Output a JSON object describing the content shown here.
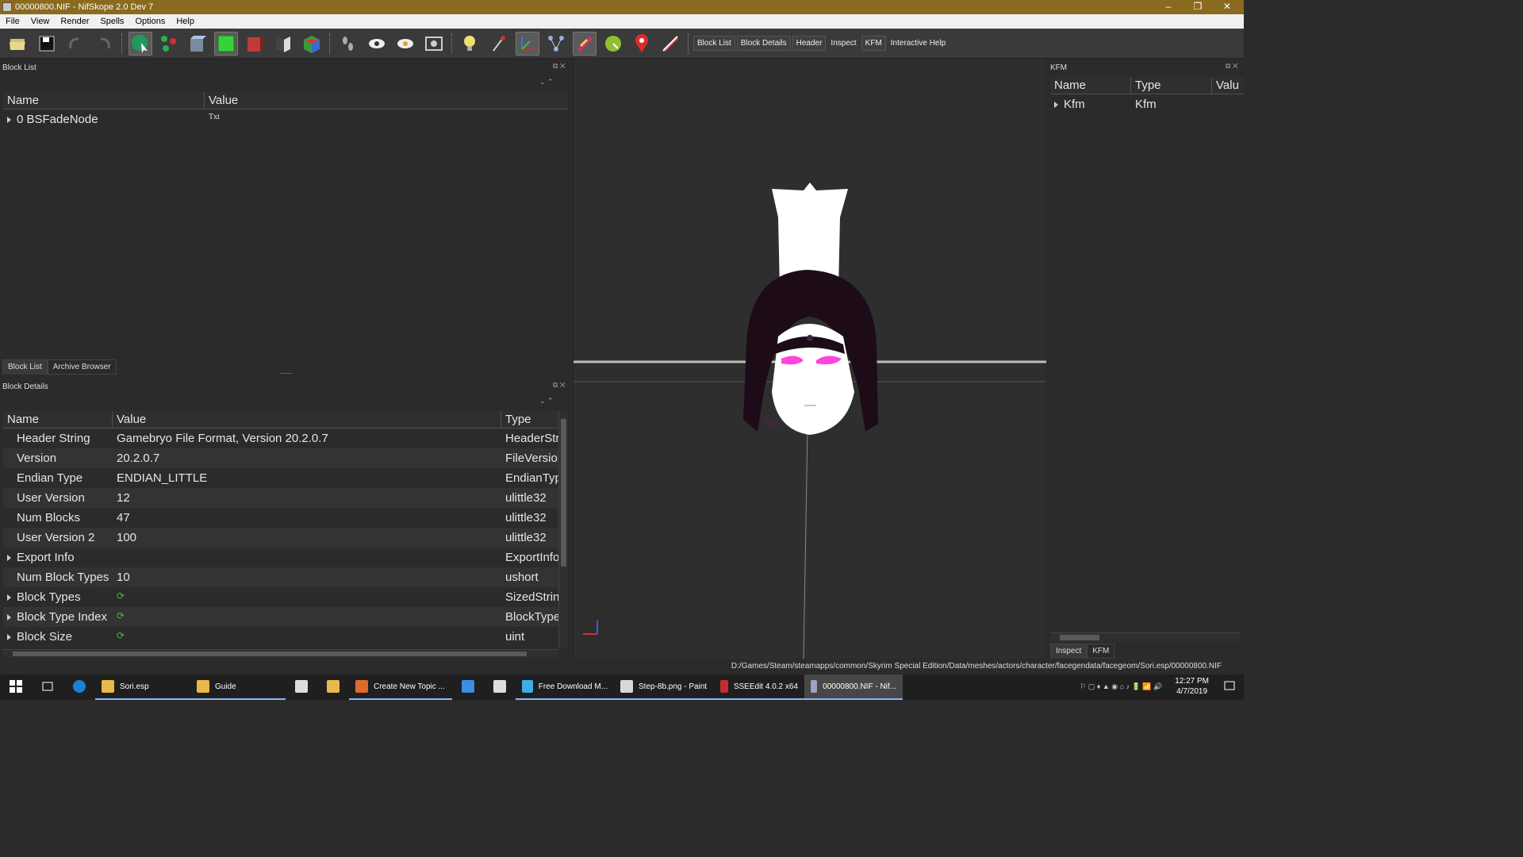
{
  "window": {
    "title": "00000800.NIF - NifSkope 2.0 Dev 7",
    "minimize": "–",
    "restore": "❐",
    "close": "✕"
  },
  "menu": [
    "File",
    "View",
    "Render",
    "Spells",
    "Options",
    "Help"
  ],
  "toolbar": {
    "icons": [
      "load-icon",
      "save-icon",
      "undo-icon",
      "redo-icon",
      "select-object-icon",
      "select-vertex-icon",
      "view-top-icon",
      "view-front-icon",
      "view-side-icon",
      "view-walk-icon",
      "view-user-icon",
      "footprints-icon",
      "eye-icon",
      "eye-hidden-icon",
      "screenshot-icon",
      "light-icon",
      "axis-pin-icon",
      "axes-icon",
      "nodes-icon",
      "havok-icon",
      "furniture-icon",
      "marker-icon",
      "constraints-icon"
    ],
    "dock_tabs": [
      "Block List",
      "Block Details",
      "Header",
      "Inspect",
      "KFM"
    ],
    "help": "Interactive Help"
  },
  "block_list": {
    "title": "Block List",
    "columns": [
      "Name",
      "Value"
    ],
    "rows": [
      {
        "name": "0 BSFadeNode",
        "value": "Txt"
      }
    ],
    "tabs": [
      "Block List",
      "Archive Browser"
    ]
  },
  "block_details": {
    "title": "Block Details",
    "columns": [
      "Name",
      "Value",
      "Type"
    ],
    "rows": [
      {
        "name": "Header String",
        "value": "Gamebryo File Format, Version 20.2.0.7",
        "type": "HeaderStr",
        "expand": false
      },
      {
        "name": "Version",
        "value": "20.2.0.7",
        "type": "FileVersio",
        "expand": false
      },
      {
        "name": "Endian Type",
        "value": "ENDIAN_LITTLE",
        "type": "EndianTyp",
        "expand": false
      },
      {
        "name": "User Version",
        "value": "12",
        "type": "ulittle32",
        "expand": false
      },
      {
        "name": "Num Blocks",
        "value": "47",
        "type": "ulittle32",
        "expand": false
      },
      {
        "name": "User Version 2",
        "value": "100",
        "type": "ulittle32",
        "expand": false
      },
      {
        "name": "Export Info",
        "value": "",
        "type": "ExportInfo",
        "expand": true
      },
      {
        "name": "Num Block Types",
        "value": "10",
        "type": "ushort",
        "expand": false
      },
      {
        "name": "Block Types",
        "value": "",
        "type": "SizedStrin",
        "expand": true,
        "refresh": true
      },
      {
        "name": "Block Type Index",
        "value": "",
        "type": "BlockType",
        "expand": true,
        "refresh": true
      },
      {
        "name": "Block Size",
        "value": "",
        "type": "uint",
        "expand": true,
        "refresh": true
      }
    ]
  },
  "kfm": {
    "title": "KFM",
    "columns": [
      "Name",
      "Type",
      "Valu"
    ],
    "rows": [
      {
        "name": "Kfm",
        "type": "Kfm"
      }
    ],
    "tabs": [
      "Inspect",
      "KFM"
    ]
  },
  "status": {
    "path": "D:/Games/Steam/steamapps/common/Skyrim Special Edition/Data/meshes/actors/character/facegendata/facegeom/Sori.esp/00000800.NIF"
  },
  "taskbar": {
    "items": [
      {
        "label": "Sori.esp",
        "icon": "folder-icon",
        "color": "#e8b84a"
      },
      {
        "label": "Guide",
        "icon": "folder-icon",
        "color": "#e8b84a"
      },
      {
        "label": "",
        "icon": "store-icon",
        "color": "#dddddd"
      },
      {
        "label": "",
        "icon": "chrome-icon",
        "color": "#e8b84a"
      },
      {
        "label": "Create New Topic ...",
        "icon": "firefox-icon",
        "color": "#e06a2a"
      },
      {
        "label": "",
        "icon": "ie-icon",
        "color": "#3a8ee6"
      },
      {
        "label": "",
        "icon": "mail-icon",
        "color": "#dddddd"
      },
      {
        "label": "Free Download M...",
        "icon": "download-icon",
        "color": "#3ab0e6"
      },
      {
        "label": "Step-8b.png - Paint",
        "icon": "paint-icon",
        "color": "#d8d8d8"
      },
      {
        "label": "SSEEdit 4.0.2 x64",
        "icon": "sseedit-icon",
        "color": "#c03030"
      },
      {
        "label": "00000800.NIF - Nif...",
        "icon": "nifskope-icon",
        "color": "#9aa4c8"
      }
    ],
    "clock_time": "12:27 PM",
    "clock_date": "4/7/2019"
  }
}
